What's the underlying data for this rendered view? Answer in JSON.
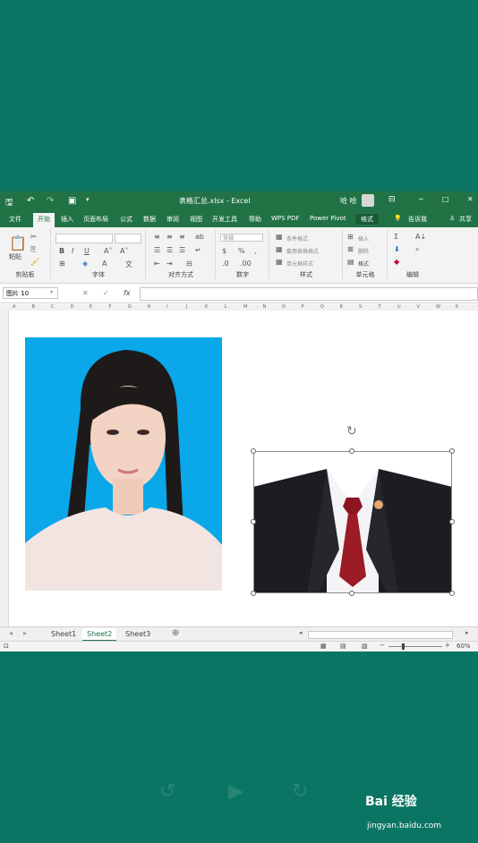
{
  "window": {
    "title": "表格汇总.xlsx - Excel",
    "user": "哈 哈",
    "controls": [
      "─",
      "□",
      "✕"
    ]
  },
  "tabs": [
    {
      "label": "文件"
    },
    {
      "label": "开始"
    },
    {
      "label": "插入"
    },
    {
      "label": "页面布局"
    },
    {
      "label": "公式"
    },
    {
      "label": "数据"
    },
    {
      "label": "审阅"
    },
    {
      "label": "视图"
    },
    {
      "label": "开发工具"
    },
    {
      "label": "帮助"
    },
    {
      "label": "WPS PDF"
    },
    {
      "label": "Power Pivot"
    },
    {
      "label": "格式"
    }
  ],
  "tell_me": "告诉我",
  "share": "共享",
  "ribbon": {
    "groups": [
      "剪贴板",
      "字体",
      "对齐方式",
      "数字",
      "样式",
      "单元格",
      "编辑"
    ],
    "paste": "粘贴",
    "number_format": "常规",
    "styles": [
      "条件格式",
      "套用表格格式",
      "单元格样式"
    ],
    "cells": [
      "插入",
      "删除",
      "格式"
    ],
    "font_buttons": [
      "B",
      "I",
      "U"
    ]
  },
  "formula_bar": {
    "name_box": "图片 10",
    "fx": "fx",
    "cancel": "✕",
    "enter": "✓"
  },
  "columns": [
    "A",
    "B",
    "C",
    "D",
    "E",
    "F",
    "G",
    "H",
    "I",
    "J",
    "K",
    "L",
    "M",
    "N",
    "O",
    "P",
    "Q",
    "R",
    "S",
    "T",
    "U",
    "V",
    "W",
    "X"
  ],
  "sheets": [
    {
      "label": "Sheet1"
    },
    {
      "label": "Sheet2"
    },
    {
      "label": "Sheet3"
    }
  ],
  "active_sheet": "Sheet2",
  "status": {
    "zoom": "60%"
  },
  "watermark": {
    "brand": "Bai  经验",
    "url": "jingyan.baidu.com"
  },
  "colors": {
    "excel_green": "#217346",
    "background": "#0b7563",
    "photo_bg": "#0aa7e9"
  }
}
